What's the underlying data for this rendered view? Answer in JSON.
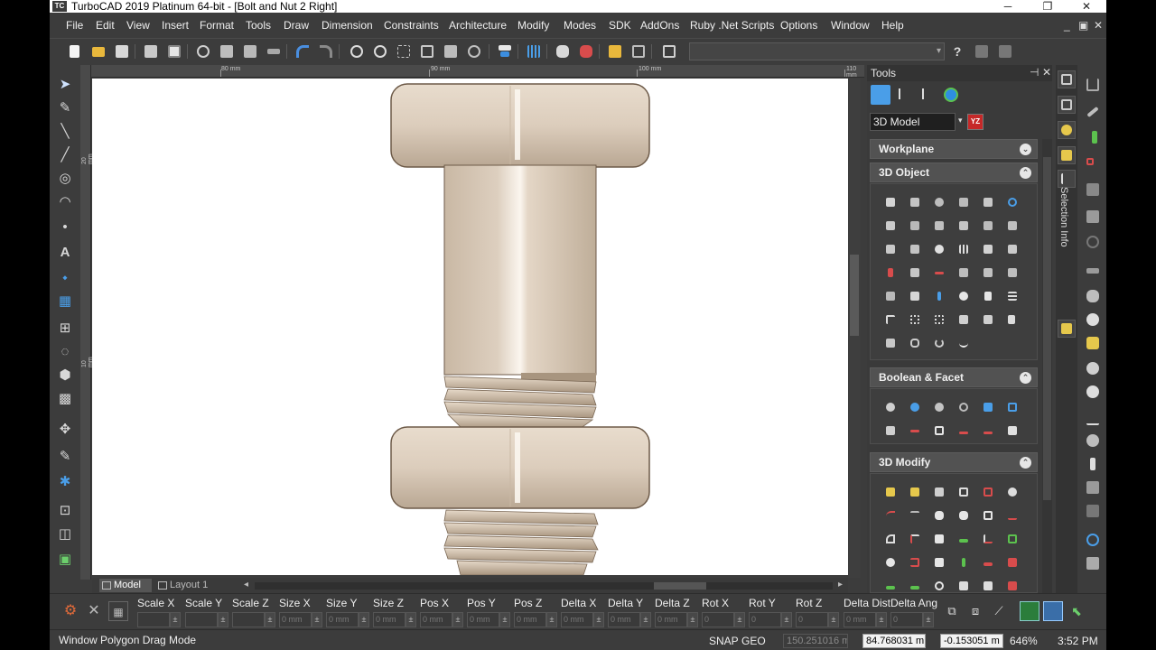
{
  "app": {
    "logo_text": "TC",
    "title": "TurboCAD 2019 Platinum 64-bit - [Bolt and Nut 2 Right]",
    "window_controls": {
      "minimize": "─",
      "restore": "❐",
      "close": "✕"
    },
    "mdi_controls": {
      "minimize": "_",
      "restore": "▣",
      "close": "✕"
    }
  },
  "menu": {
    "items": [
      {
        "label": "File"
      },
      {
        "label": "Edit"
      },
      {
        "label": "View"
      },
      {
        "label": "Insert"
      },
      {
        "label": "Format"
      },
      {
        "label": "Tools"
      },
      {
        "label": "Draw"
      },
      {
        "label": "Dimension"
      },
      {
        "label": "Constraints"
      },
      {
        "label": "Architecture"
      },
      {
        "label": "Modify"
      },
      {
        "label": "Modes"
      },
      {
        "label": "SDK"
      },
      {
        "label": "AddOns"
      },
      {
        "label": "Ruby .Net Scripts"
      },
      {
        "label": "Options"
      },
      {
        "label": "Window"
      },
      {
        "label": "Help"
      }
    ]
  },
  "toolbar": {
    "icons": [
      "new-file-icon",
      "open-folder-icon",
      "save-icon",
      "print-icon",
      "print-preview-icon",
      "cut-icon",
      "copy-icon",
      "paste-icon",
      "format-painter-icon",
      "undo-icon",
      "redo-icon",
      "zoom-in-icon",
      "zoom-out-icon",
      "zoom-window-icon",
      "zoom-extents-icon",
      "zoom-page-icon",
      "zoom-previous-icon",
      "spell-check-icon",
      "grid-icon",
      "pan-icon",
      "select-icon",
      "group-icon",
      "block-icon",
      "explode-icon",
      "layer-icon"
    ],
    "combo_value": "",
    "combo_arrow": "▾",
    "help_icon": "?"
  },
  "left_tools": {
    "glyphs": [
      "➤",
      "✎",
      "╲",
      "╱",
      "◎",
      "◠",
      "•",
      "A",
      "⬩",
      "▦",
      "⊞",
      "◌",
      "⬢",
      "▩",
      "✥",
      "✎",
      "✱",
      "⊡",
      "◫",
      "▣"
    ]
  },
  "rulers": {
    "h_labels": [
      "80 mm",
      "90 mm",
      "100 mm",
      "110 mm"
    ],
    "v_labels": [
      "20 mm",
      "10 mm"
    ]
  },
  "canvas": {
    "colors": {
      "part_fill": "#dccdbc",
      "part_shadow": "#a89580",
      "part_highlight": "#fbf6ef",
      "outline": "#5b4a3a"
    }
  },
  "tabs": {
    "model": "Model",
    "layout": "Layout 1",
    "prev": "◂",
    "next": "▸"
  },
  "panel": {
    "title": "Tools",
    "pin": "⊣",
    "close": "✕",
    "mode": "3D Model",
    "mode_arrow": "▾",
    "mode_btn": "YZ",
    "sections": [
      {
        "title": "Workplane",
        "toggle": "⌄"
      },
      {
        "title": "3D Object",
        "toggle": "⌃"
      },
      {
        "title": "Boolean & Facet",
        "toggle": "⌃"
      },
      {
        "title": "3D Modify",
        "toggle": "⌃"
      }
    ],
    "accent": "#4a9ee8"
  },
  "side_tabs": {
    "selection_info": "Selection Info"
  },
  "inspector": {
    "fields": [
      {
        "label": "Scale X",
        "value": ""
      },
      {
        "label": "Scale Y",
        "value": ""
      },
      {
        "label": "Scale Z",
        "value": ""
      },
      {
        "label": "Size X",
        "value": "0 mm"
      },
      {
        "label": "Size Y",
        "value": "0 mm"
      },
      {
        "label": "Size Z",
        "value": "0 mm"
      },
      {
        "label": "Pos X",
        "value": "0 mm"
      },
      {
        "label": "Pos Y",
        "value": "0 mm"
      },
      {
        "label": "Pos Z",
        "value": "0 mm"
      },
      {
        "label": "Delta X",
        "value": "0 mm"
      },
      {
        "label": "Delta Y",
        "value": "0 mm"
      },
      {
        "label": "Delta Z",
        "value": "0 mm"
      },
      {
        "label": "Rot X",
        "value": "0"
      },
      {
        "label": "Rot Y",
        "value": "0"
      },
      {
        "label": "Rot Z",
        "value": "0"
      },
      {
        "label": "Delta Dist",
        "value": "0 mm"
      },
      {
        "label": "Delta Ang",
        "value": "0"
      }
    ],
    "spin": "±",
    "close_glyph": "✕"
  },
  "status": {
    "message": "Window Polygon Drag Mode",
    "snap": "SNAP",
    "geo": "GEO",
    "x": "150.251016 m",
    "y": "84.768031 m",
    "z": "-0.153051 m",
    "zoom": "646%",
    "time": "3:52 PM"
  }
}
